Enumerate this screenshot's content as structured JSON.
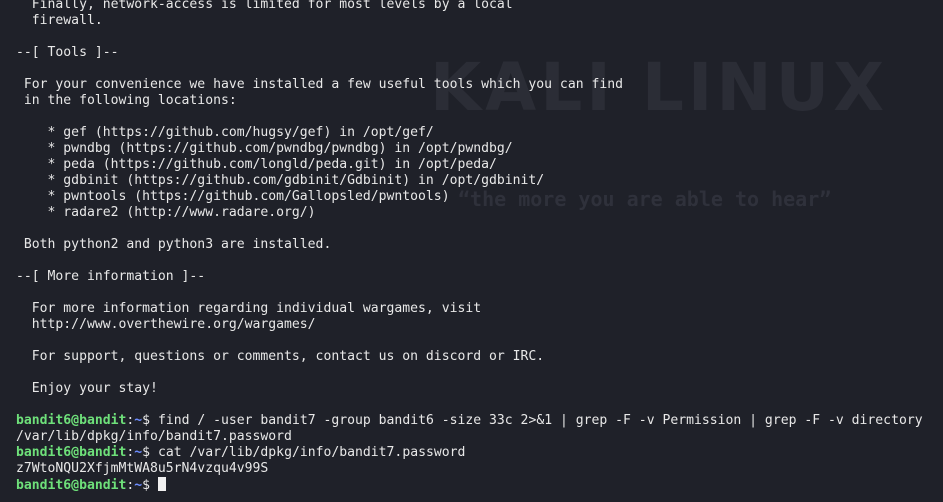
{
  "terminal": {
    "wallpaper": {
      "logo_text": "KALI LINUX",
      "tagline": "“the more you are able to hear”"
    },
    "motd": [
      "  Finally, network-access is limited for most levels by a local",
      "  firewall.",
      "",
      "--[ Tools ]--",
      "",
      " For your convenience we have installed a few useful tools which you can find",
      " in the following locations:",
      "",
      "    * gef (https://github.com/hugsy/gef) in /opt/gef/",
      "    * pwndbg (https://github.com/pwndbg/pwndbg) in /opt/pwndbg/",
      "    * peda (https://github.com/longld/peda.git) in /opt/peda/",
      "    * gdbinit (https://github.com/gdbinit/Gdbinit) in /opt/gdbinit/",
      "    * pwntools (https://github.com/Gallopsled/pwntools)",
      "    * radare2 (http://www.radare.org/)",
      "",
      " Both python2 and python3 are installed.",
      "",
      "--[ More information ]--",
      "",
      "  For more information regarding individual wargames, visit",
      "  http://www.overthewire.org/wargames/",
      "",
      "  For support, questions or comments, contact us on discord or IRC.",
      "",
      "  Enjoy your stay!",
      ""
    ],
    "session": [
      {
        "prompt_user": "bandit6@bandit",
        "prompt_sep": ":",
        "prompt_path": "~",
        "prompt_symbol": "$ ",
        "command": "find / -user bandit7 -group bandit6 -size 33c 2>&1 | grep -F -v Permission | grep -F -v directory",
        "output": "/var/lib/dpkg/info/bandit7.password"
      },
      {
        "prompt_user": "bandit6@bandit",
        "prompt_sep": ":",
        "prompt_path": "~",
        "prompt_symbol": "$ ",
        "command": "cat /var/lib/dpkg/info/bandit7.password",
        "output": "z7WtoNQU2XfjmMtWA8u5rN4vzqu4v99S"
      },
      {
        "prompt_user": "bandit6@bandit",
        "prompt_sep": ":",
        "prompt_path": "~",
        "prompt_symbol": "$ ",
        "command": "",
        "output": null
      }
    ],
    "colors": {
      "background": "#1f2129",
      "text": "#e8e8e8",
      "prompt_user": "#6ee07a",
      "prompt_path": "#6d8dff",
      "wallpaper_logo": "#2b2d36",
      "wallpaper_tagline": "#2f313b"
    }
  }
}
